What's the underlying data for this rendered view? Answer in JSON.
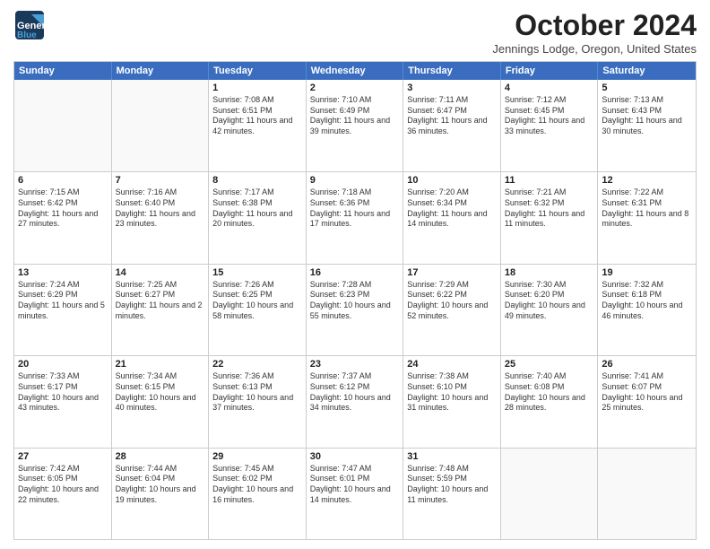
{
  "logo": {
    "line1": "General",
    "line2": "Blue"
  },
  "title": "October 2024",
  "location": "Jennings Lodge, Oregon, United States",
  "header_days": [
    "Sunday",
    "Monday",
    "Tuesday",
    "Wednesday",
    "Thursday",
    "Friday",
    "Saturday"
  ],
  "weeks": [
    [
      {
        "day": "",
        "sunrise": "",
        "sunset": "",
        "daylight": ""
      },
      {
        "day": "",
        "sunrise": "",
        "sunset": "",
        "daylight": ""
      },
      {
        "day": "1",
        "sunrise": "Sunrise: 7:08 AM",
        "sunset": "Sunset: 6:51 PM",
        "daylight": "Daylight: 11 hours and 42 minutes."
      },
      {
        "day": "2",
        "sunrise": "Sunrise: 7:10 AM",
        "sunset": "Sunset: 6:49 PM",
        "daylight": "Daylight: 11 hours and 39 minutes."
      },
      {
        "day": "3",
        "sunrise": "Sunrise: 7:11 AM",
        "sunset": "Sunset: 6:47 PM",
        "daylight": "Daylight: 11 hours and 36 minutes."
      },
      {
        "day": "4",
        "sunrise": "Sunrise: 7:12 AM",
        "sunset": "Sunset: 6:45 PM",
        "daylight": "Daylight: 11 hours and 33 minutes."
      },
      {
        "day": "5",
        "sunrise": "Sunrise: 7:13 AM",
        "sunset": "Sunset: 6:43 PM",
        "daylight": "Daylight: 11 hours and 30 minutes."
      }
    ],
    [
      {
        "day": "6",
        "sunrise": "Sunrise: 7:15 AM",
        "sunset": "Sunset: 6:42 PM",
        "daylight": "Daylight: 11 hours and 27 minutes."
      },
      {
        "day": "7",
        "sunrise": "Sunrise: 7:16 AM",
        "sunset": "Sunset: 6:40 PM",
        "daylight": "Daylight: 11 hours and 23 minutes."
      },
      {
        "day": "8",
        "sunrise": "Sunrise: 7:17 AM",
        "sunset": "Sunset: 6:38 PM",
        "daylight": "Daylight: 11 hours and 20 minutes."
      },
      {
        "day": "9",
        "sunrise": "Sunrise: 7:18 AM",
        "sunset": "Sunset: 6:36 PM",
        "daylight": "Daylight: 11 hours and 17 minutes."
      },
      {
        "day": "10",
        "sunrise": "Sunrise: 7:20 AM",
        "sunset": "Sunset: 6:34 PM",
        "daylight": "Daylight: 11 hours and 14 minutes."
      },
      {
        "day": "11",
        "sunrise": "Sunrise: 7:21 AM",
        "sunset": "Sunset: 6:32 PM",
        "daylight": "Daylight: 11 hours and 11 minutes."
      },
      {
        "day": "12",
        "sunrise": "Sunrise: 7:22 AM",
        "sunset": "Sunset: 6:31 PM",
        "daylight": "Daylight: 11 hours and 8 minutes."
      }
    ],
    [
      {
        "day": "13",
        "sunrise": "Sunrise: 7:24 AM",
        "sunset": "Sunset: 6:29 PM",
        "daylight": "Daylight: 11 hours and 5 minutes."
      },
      {
        "day": "14",
        "sunrise": "Sunrise: 7:25 AM",
        "sunset": "Sunset: 6:27 PM",
        "daylight": "Daylight: 11 hours and 2 minutes."
      },
      {
        "day": "15",
        "sunrise": "Sunrise: 7:26 AM",
        "sunset": "Sunset: 6:25 PM",
        "daylight": "Daylight: 10 hours and 58 minutes."
      },
      {
        "day": "16",
        "sunrise": "Sunrise: 7:28 AM",
        "sunset": "Sunset: 6:23 PM",
        "daylight": "Daylight: 10 hours and 55 minutes."
      },
      {
        "day": "17",
        "sunrise": "Sunrise: 7:29 AM",
        "sunset": "Sunset: 6:22 PM",
        "daylight": "Daylight: 10 hours and 52 minutes."
      },
      {
        "day": "18",
        "sunrise": "Sunrise: 7:30 AM",
        "sunset": "Sunset: 6:20 PM",
        "daylight": "Daylight: 10 hours and 49 minutes."
      },
      {
        "day": "19",
        "sunrise": "Sunrise: 7:32 AM",
        "sunset": "Sunset: 6:18 PM",
        "daylight": "Daylight: 10 hours and 46 minutes."
      }
    ],
    [
      {
        "day": "20",
        "sunrise": "Sunrise: 7:33 AM",
        "sunset": "Sunset: 6:17 PM",
        "daylight": "Daylight: 10 hours and 43 minutes."
      },
      {
        "day": "21",
        "sunrise": "Sunrise: 7:34 AM",
        "sunset": "Sunset: 6:15 PM",
        "daylight": "Daylight: 10 hours and 40 minutes."
      },
      {
        "day": "22",
        "sunrise": "Sunrise: 7:36 AM",
        "sunset": "Sunset: 6:13 PM",
        "daylight": "Daylight: 10 hours and 37 minutes."
      },
      {
        "day": "23",
        "sunrise": "Sunrise: 7:37 AM",
        "sunset": "Sunset: 6:12 PM",
        "daylight": "Daylight: 10 hours and 34 minutes."
      },
      {
        "day": "24",
        "sunrise": "Sunrise: 7:38 AM",
        "sunset": "Sunset: 6:10 PM",
        "daylight": "Daylight: 10 hours and 31 minutes."
      },
      {
        "day": "25",
        "sunrise": "Sunrise: 7:40 AM",
        "sunset": "Sunset: 6:08 PM",
        "daylight": "Daylight: 10 hours and 28 minutes."
      },
      {
        "day": "26",
        "sunrise": "Sunrise: 7:41 AM",
        "sunset": "Sunset: 6:07 PM",
        "daylight": "Daylight: 10 hours and 25 minutes."
      }
    ],
    [
      {
        "day": "27",
        "sunrise": "Sunrise: 7:42 AM",
        "sunset": "Sunset: 6:05 PM",
        "daylight": "Daylight: 10 hours and 22 minutes."
      },
      {
        "day": "28",
        "sunrise": "Sunrise: 7:44 AM",
        "sunset": "Sunset: 6:04 PM",
        "daylight": "Daylight: 10 hours and 19 minutes."
      },
      {
        "day": "29",
        "sunrise": "Sunrise: 7:45 AM",
        "sunset": "Sunset: 6:02 PM",
        "daylight": "Daylight: 10 hours and 16 minutes."
      },
      {
        "day": "30",
        "sunrise": "Sunrise: 7:47 AM",
        "sunset": "Sunset: 6:01 PM",
        "daylight": "Daylight: 10 hours and 14 minutes."
      },
      {
        "day": "31",
        "sunrise": "Sunrise: 7:48 AM",
        "sunset": "Sunset: 5:59 PM",
        "daylight": "Daylight: 10 hours and 11 minutes."
      },
      {
        "day": "",
        "sunrise": "",
        "sunset": "",
        "daylight": ""
      },
      {
        "day": "",
        "sunrise": "",
        "sunset": "",
        "daylight": ""
      }
    ]
  ]
}
